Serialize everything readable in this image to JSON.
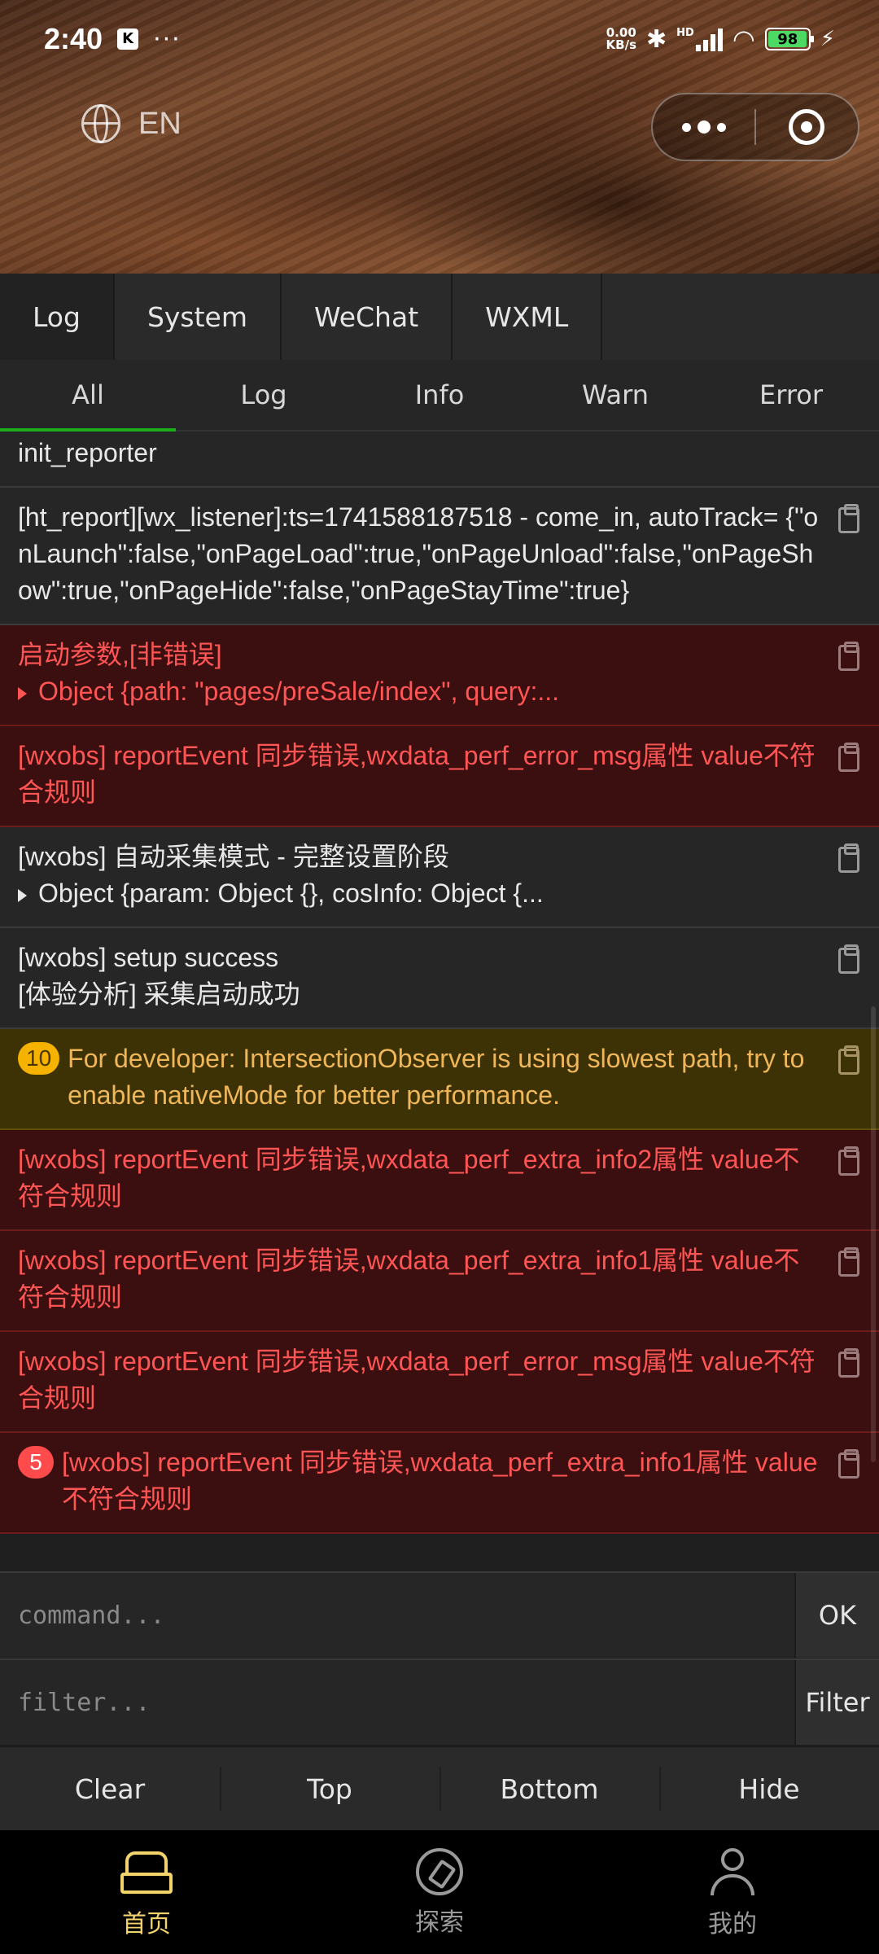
{
  "status_bar": {
    "time": "2:40",
    "notif_badge": "K",
    "more_dots": "···",
    "net_speed_top": "0.00",
    "net_speed_bottom": "KB/s",
    "bluetooth": "✱",
    "network": "HD",
    "battery": "98",
    "battery_level": 0.98,
    "charging": "⚡"
  },
  "header": {
    "language": "EN",
    "capsule": {
      "more_icon": "more-dots-icon",
      "close_icon": "target-close-icon"
    }
  },
  "vconsole": {
    "tabs": [
      "Log",
      "System",
      "WeChat",
      "WXML"
    ],
    "active_tab": "Log",
    "subtabs": [
      "All",
      "Log",
      "Info",
      "Warn",
      "Error"
    ],
    "active_subtab": "All",
    "logs": [
      {
        "type": "log",
        "lines": [
          "init_reporter"
        ]
      },
      {
        "type": "log",
        "lines": [
          "[ht_report][wx_listener]:ts=1741588187518 - come_in, autoTrack= {\"onLaunch\":false,\"onPageLoad\":true,\"onPageUnload\":false,\"onPageShow\":true,\"onPageHide\":false,\"onPageStayTime\":true}"
        ]
      },
      {
        "type": "error",
        "lines": [
          "启动参数,[非错误]"
        ],
        "object": "Object {path: \"pages/preSale/index\", query:..."
      },
      {
        "type": "error",
        "lines": [
          "[wxobs] reportEvent 同步错误,wxdata_perf_error_msg属性 value不符合规则"
        ]
      },
      {
        "type": "log",
        "lines": [
          "[wxobs] 自动采集模式 - 完整设置阶段"
        ],
        "object": "Object {param: Object {}, cosInfo: Object {..."
      },
      {
        "type": "log",
        "lines": [
          "[wxobs] setup success",
          "[体验分析] 采集启动成功"
        ]
      },
      {
        "type": "warn",
        "badge": "10",
        "lines": [
          "For developer: IntersectionObserver is using slowest path, try to enable nativeMode for better performance."
        ]
      },
      {
        "type": "error",
        "lines": [
          "[wxobs] reportEvent 同步错误,wxdata_perf_extra_info2属性 value不符合规则"
        ]
      },
      {
        "type": "error",
        "lines": [
          "[wxobs] reportEvent 同步错误,wxdata_perf_extra_info1属性 value不符合规则"
        ]
      },
      {
        "type": "error",
        "lines": [
          "[wxobs] reportEvent 同步错误,wxdata_perf_error_msg属性 value不符合规则"
        ]
      },
      {
        "type": "error",
        "badge": "5",
        "lines": [
          "[wxobs] reportEvent 同步错误,wxdata_perf_extra_info1属性 value不符合规则"
        ]
      }
    ],
    "command": {
      "placeholder": "command...",
      "button": "OK"
    },
    "filter": {
      "placeholder": "filter...",
      "button": "Filter"
    },
    "toolbar": [
      "Clear",
      "Top",
      "Bottom",
      "Hide"
    ]
  },
  "bottom_nav": {
    "items": [
      {
        "label": "首页",
        "icon": "home-icon",
        "active": true
      },
      {
        "label": "探索",
        "icon": "compass-icon",
        "active": false
      },
      {
        "label": "我的",
        "icon": "user-icon",
        "active": false
      }
    ]
  },
  "colors": {
    "error_bg": "#3b0f0f",
    "error_text": "#ff5555",
    "warn_bg": "#3d3205",
    "warn_text": "#f0b65a",
    "nav_active": "#f3d36b",
    "tab_underline": "#1aad19"
  }
}
